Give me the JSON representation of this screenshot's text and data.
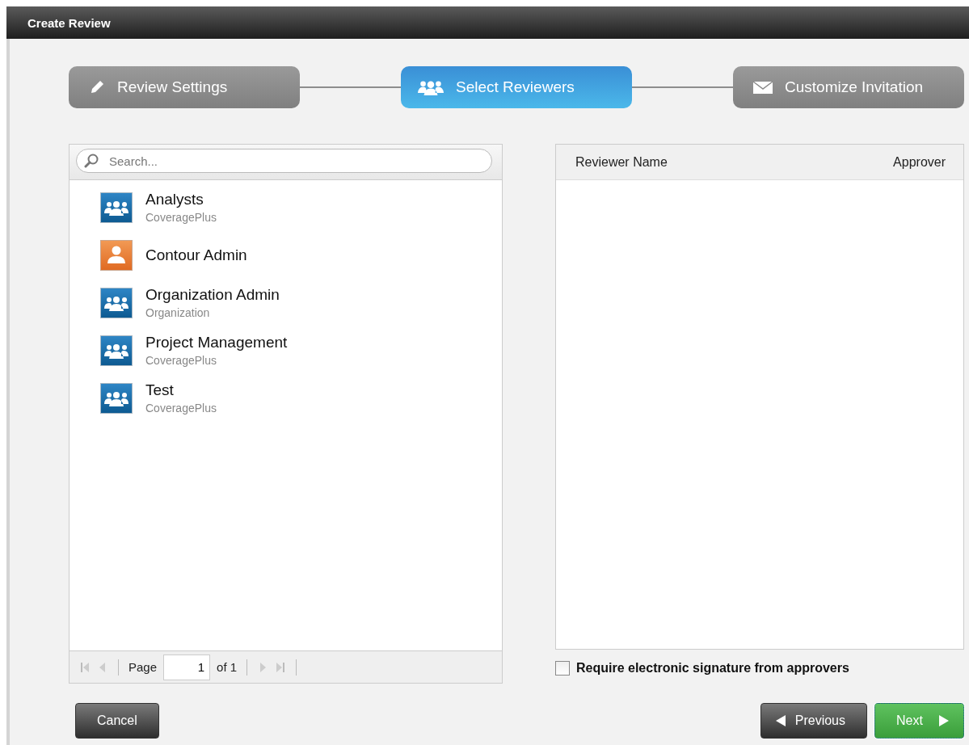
{
  "window": {
    "title": "Create Review"
  },
  "steps": [
    {
      "label": "Review Settings",
      "kind": "pencil",
      "selected": false
    },
    {
      "label": "Select Reviewers",
      "kind": "group",
      "selected": true
    },
    {
      "label": "Customize Invitation",
      "kind": "envelope",
      "selected": false
    }
  ],
  "search": {
    "placeholder": "Search..."
  },
  "reviewers": [
    {
      "name": "Analysts",
      "subtitle": "CoveragePlus",
      "kind": "group"
    },
    {
      "name": "Contour Admin",
      "kind": "user"
    },
    {
      "name": "Organization Admin",
      "subtitle": "Organization",
      "kind": "group"
    },
    {
      "name": "Project Management",
      "subtitle": "CoveragePlus",
      "kind": "group"
    },
    {
      "name": "Test",
      "subtitle": "CoveragePlus",
      "kind": "group"
    }
  ],
  "pager": {
    "page_label": "Page",
    "page": "1",
    "of_label": "of 1"
  },
  "selected_table": {
    "columns": [
      "Reviewer Name",
      "Approver"
    ]
  },
  "signature_checkbox": {
    "label": "Require electronic signature from approvers",
    "checked": false
  },
  "buttons": {
    "cancel": "Cancel",
    "previous": "Previous",
    "next": "Next"
  }
}
